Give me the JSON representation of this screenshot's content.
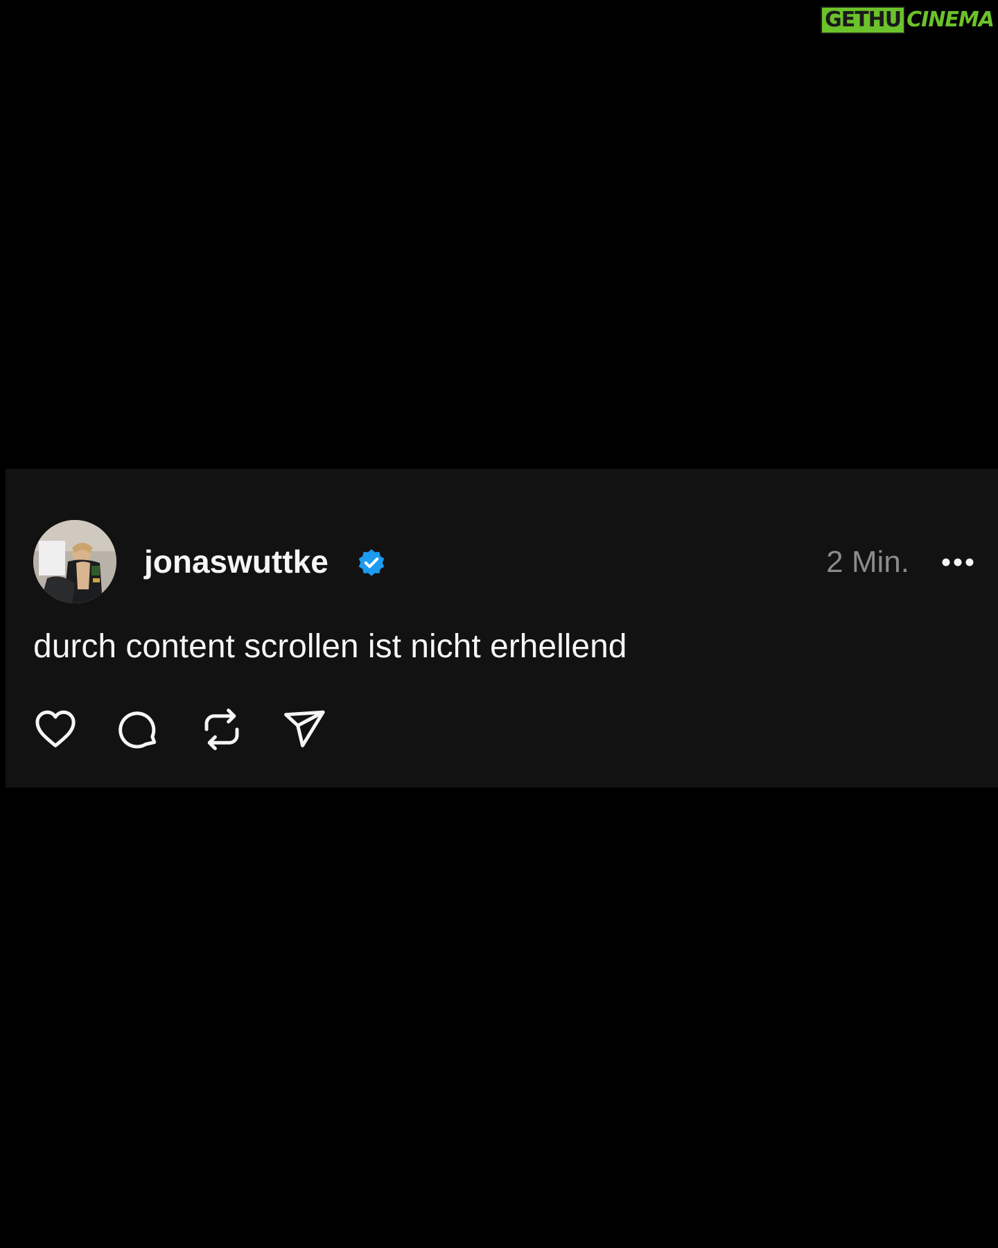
{
  "watermark": {
    "logo_text": "GETHUCINEMA",
    "colors": {
      "primary": "#6bc22a",
      "outline": "#1a1a1a"
    }
  },
  "post": {
    "username": "jonaswuttke",
    "verified": true,
    "timestamp": "2 Min.",
    "text": "durch content scrollen ist nicht erhellend",
    "actions": [
      {
        "icon": "heart-icon"
      },
      {
        "icon": "comment-icon"
      },
      {
        "icon": "repost-icon"
      },
      {
        "icon": "share-icon"
      }
    ],
    "more_icon": "more-options-icon",
    "colors": {
      "background": "#000000",
      "card": "#121212",
      "text": "#f5f5f5",
      "muted": "#8b8b8b",
      "verified": "#1d9bf0"
    }
  }
}
